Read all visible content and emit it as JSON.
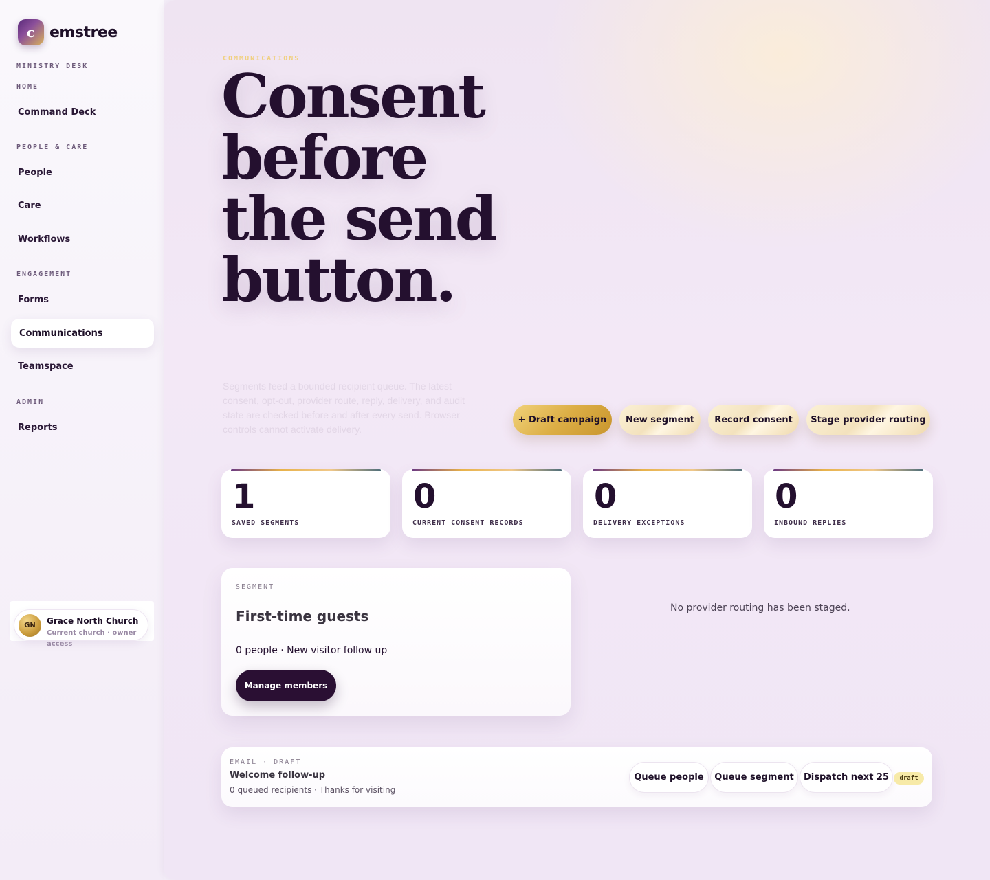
{
  "sidebar": {
    "brand": {
      "mark": "c",
      "name": "emstree"
    },
    "sections": {
      "ministry_desk": "MINISTRY DESK",
      "home": "HOME",
      "people_care": "PEOPLE & CARE",
      "engagement": "ENGAGEMENT",
      "admin": "ADMIN"
    },
    "items": {
      "command_deck": "Command Deck",
      "people": "People",
      "care": "Care",
      "workflows": "Workflows",
      "forms": "Forms",
      "communications": "Communications",
      "teamspace": "Teamspace",
      "reports": "Reports"
    },
    "active_item": "Communications",
    "church": {
      "initials": "GN",
      "name": "Grace North Church",
      "role": "Current church · owner access"
    }
  },
  "hero": {
    "eyebrow": "COMMUNICATIONS",
    "title": "Consent before the send button.",
    "description": "Segments feed a bounded recipient queue. The latest consent, opt-out, provider route, reply, delivery, and audit state are checked before and after every send. Browser controls cannot activate delivery."
  },
  "actions": {
    "draft_campaign": "+ Draft campaign",
    "new_segment": "New segment",
    "record_consent": "Record consent",
    "stage_provider_routing": "Stage provider routing"
  },
  "stats": [
    {
      "value": "1",
      "label": "SAVED SEGMENTS"
    },
    {
      "value": "0",
      "label": "CURRENT CONSENT RECORDS"
    },
    {
      "value": "0",
      "label": "DELIVERY EXCEPTIONS"
    },
    {
      "value": "0",
      "label": "INBOUND REPLIES"
    }
  ],
  "segment": {
    "eyebrow": "SEGMENT",
    "title": "First-time guests",
    "meta": "0 people · New visitor follow up",
    "manage_label": "Manage members"
  },
  "routing": {
    "empty": "No provider routing has been staged."
  },
  "campaign": {
    "eyebrow": "EMAIL · DRAFT",
    "title": "Welcome follow-up",
    "meta": "0 queued recipients · Thanks for visiting",
    "queue_people": "Queue people",
    "queue_segment": "Queue segment",
    "dispatch": "Dispatch next 25",
    "status": "draft"
  },
  "colors": {
    "ink": "#24102f",
    "gold": "#dcae45",
    "dark_button": "#2a0f33",
    "badge": "#f7eaa8"
  }
}
